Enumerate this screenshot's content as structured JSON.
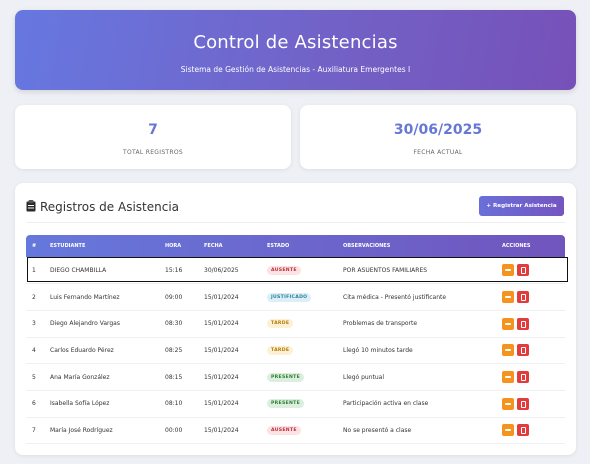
{
  "header": {
    "title": "Control de Asistencias",
    "subtitle": "Sistema de Gestión de Asistencias - Auxiliatura Emergentes I"
  },
  "stats": {
    "total_value": "7",
    "total_label": "TOTAL REGISTROS",
    "date_value": "30/06/2025",
    "date_label": "FECHA ACTUAL"
  },
  "records": {
    "title": "Registros de Asistencia",
    "register_button": "+ Registrar Asistencia",
    "columns": [
      "#",
      "ESTUDIANTE",
      "HORA",
      "FECHA",
      "ESTADO",
      "OBSERVACIONES",
      "ACCIONES"
    ],
    "rows": [
      {
        "num": "1",
        "student": "DIEGO CHAMBILLA",
        "time": "15:16",
        "date": "30/06/2025",
        "status": "AUSENTE",
        "notes": "POR ASUENTOS FAMILIARES"
      },
      {
        "num": "2",
        "student": "Luis Fernando Martínez",
        "time": "09:00",
        "date": "15/01/2024",
        "status": "JUSTIFICADO",
        "notes": "Cita médica - Presentó justificante"
      },
      {
        "num": "3",
        "student": "Diego Alejandro Vargas",
        "time": "08:30",
        "date": "15/01/2024",
        "status": "TARDE",
        "notes": "Problemas de transporte"
      },
      {
        "num": "4",
        "student": "Carlos Eduardo Pérez",
        "time": "08:25",
        "date": "15/01/2024",
        "status": "TARDE",
        "notes": "Llegó 10 minutos tarde"
      },
      {
        "num": "5",
        "student": "Ana María González",
        "time": "08:15",
        "date": "15/01/2024",
        "status": "PRESENTE",
        "notes": "Llegó puntual"
      },
      {
        "num": "6",
        "student": "Isabella Sofía López",
        "time": "08:10",
        "date": "15/01/2024",
        "status": "PRESENTE",
        "notes": "Participación activa en clase"
      },
      {
        "num": "7",
        "student": "María José Rodríguez",
        "time": "00:00",
        "date": "15/01/2024",
        "status": "AUSENTE",
        "notes": "No se presentó a clase"
      }
    ]
  },
  "colors": {
    "accent": "#6677d6",
    "edit_button": "#f5931e",
    "delete_button": "#e23b3b"
  }
}
